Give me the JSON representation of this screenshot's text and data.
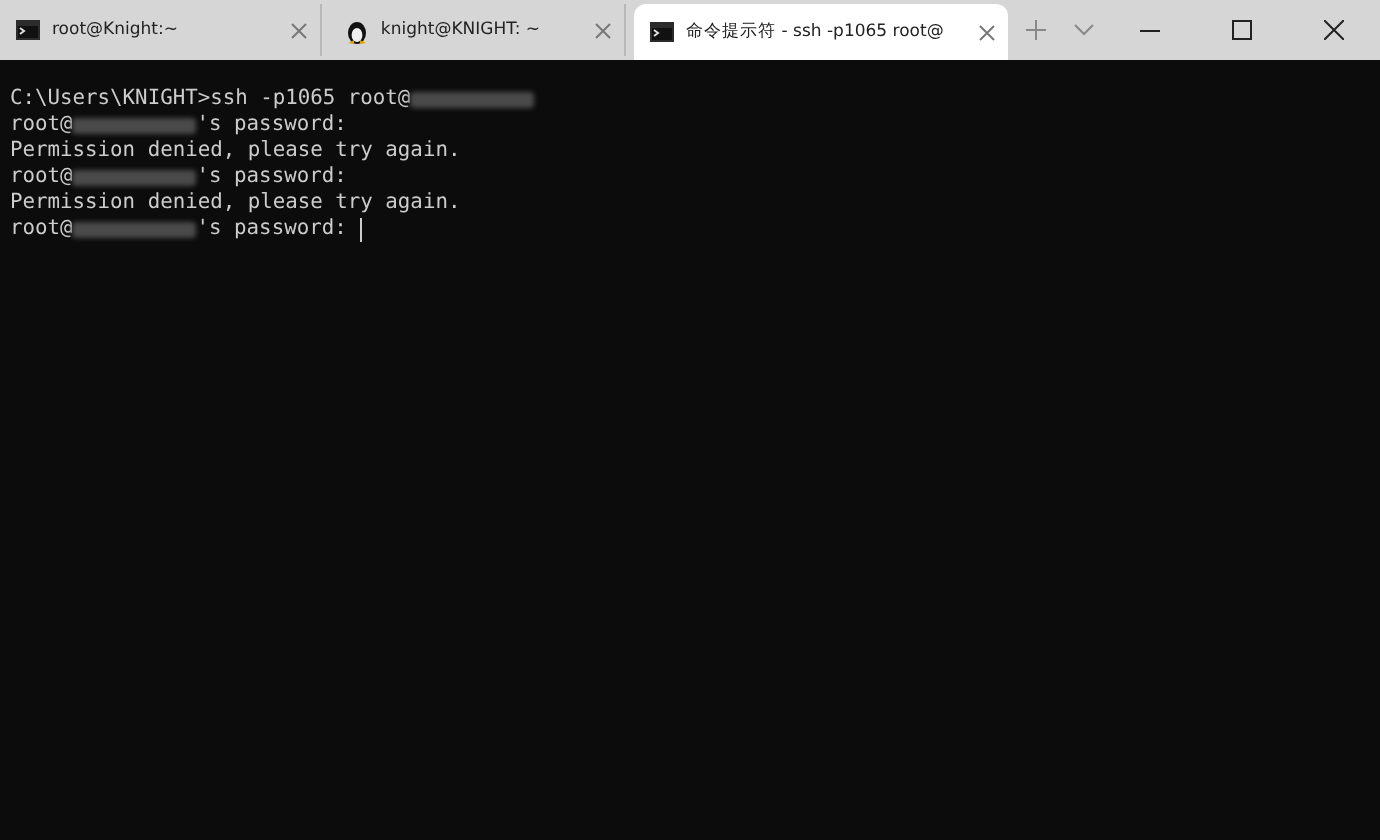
{
  "tabs": [
    {
      "kind": "console",
      "title": "root@Knight:~",
      "selected": false
    },
    {
      "kind": "penguin",
      "title": "knight@KNIGHT: ~",
      "selected": false
    },
    {
      "kind": "console",
      "title": "命令提示符 - ssh  -p1065 root@",
      "selected": true
    }
  ],
  "terminal": {
    "lines": [
      [
        {
          "kind": "text",
          "text": "C:\\Users\\KNIGHT>ssh -p1065 root@"
        },
        {
          "kind": "redacted"
        }
      ],
      [
        {
          "kind": "text",
          "text": "root@"
        },
        {
          "kind": "redacted"
        },
        {
          "kind": "text",
          "text": "'s password:"
        }
      ],
      [
        {
          "kind": "text",
          "text": "Permission denied, please try again."
        }
      ],
      [
        {
          "kind": "text",
          "text": "root@"
        },
        {
          "kind": "redacted"
        },
        {
          "kind": "text",
          "text": "'s password:"
        }
      ],
      [
        {
          "kind": "text",
          "text": "Permission denied, please try again."
        }
      ],
      [
        {
          "kind": "text",
          "text": "root@"
        },
        {
          "kind": "redacted"
        },
        {
          "kind": "text",
          "text": "'s password: "
        },
        {
          "kind": "cursor"
        }
      ]
    ]
  }
}
